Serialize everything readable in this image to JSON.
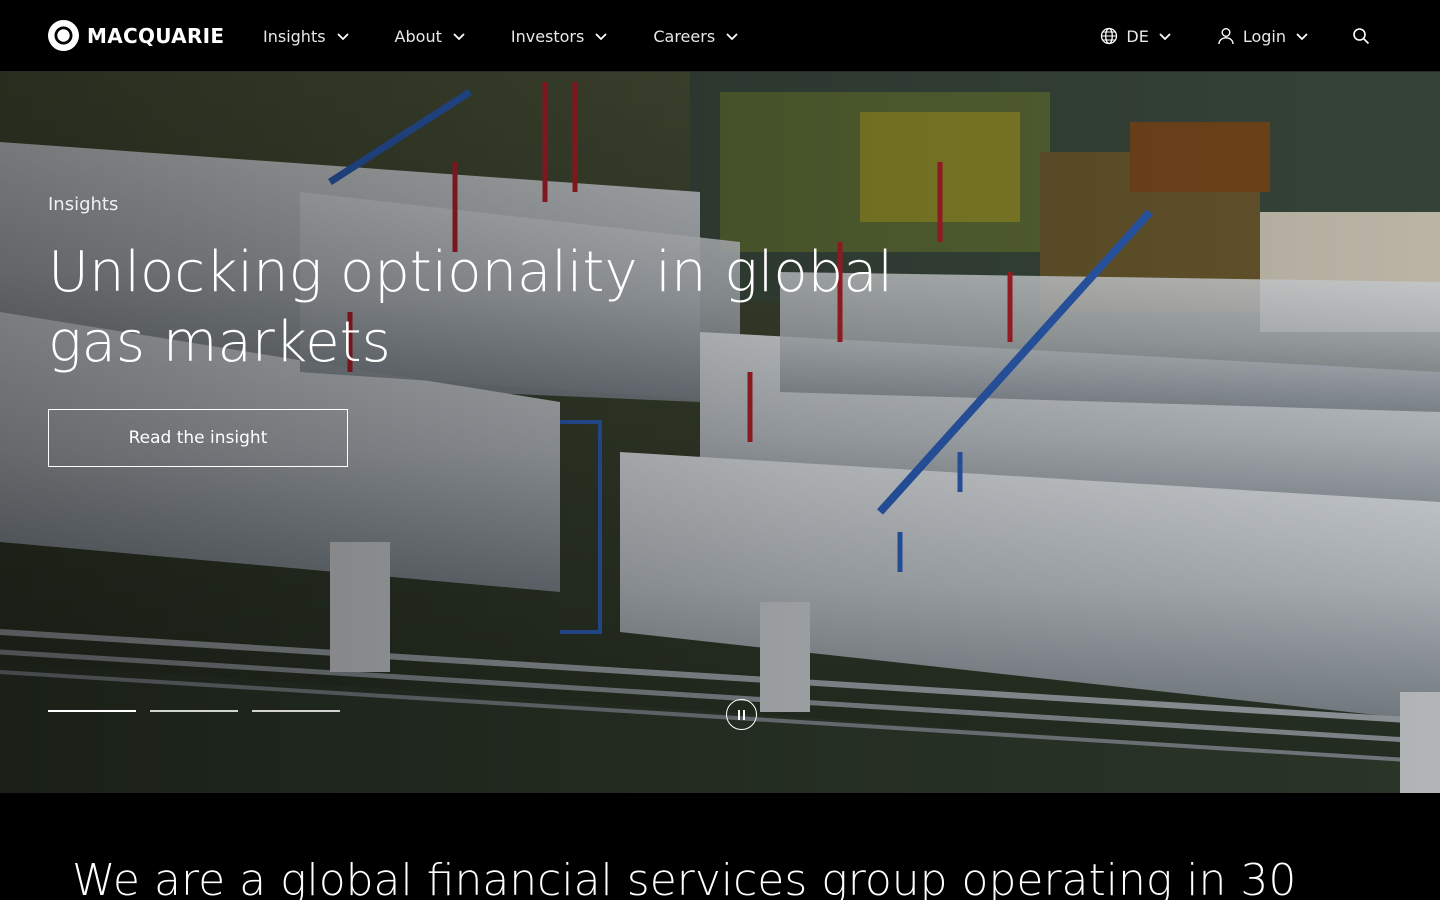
{
  "brand": {
    "name": "MACQUARIE"
  },
  "nav": {
    "items": [
      {
        "label": "Insights"
      },
      {
        "label": "About"
      },
      {
        "label": "Investors"
      },
      {
        "label": "Careers"
      }
    ]
  },
  "utility": {
    "language": "DE",
    "login": "Login"
  },
  "hero": {
    "eyebrow": "Insights",
    "headline": "Unlocking optionality in global gas markets",
    "cta": "Read the insight",
    "slides": 3,
    "active_slide": 1
  },
  "intro": {
    "text": "We are a global financial services group operating in 30"
  },
  "icons": [
    "macquarie-logo-icon",
    "chevron-down-icon",
    "globe-icon",
    "user-icon",
    "search-icon",
    "pause-icon"
  ]
}
